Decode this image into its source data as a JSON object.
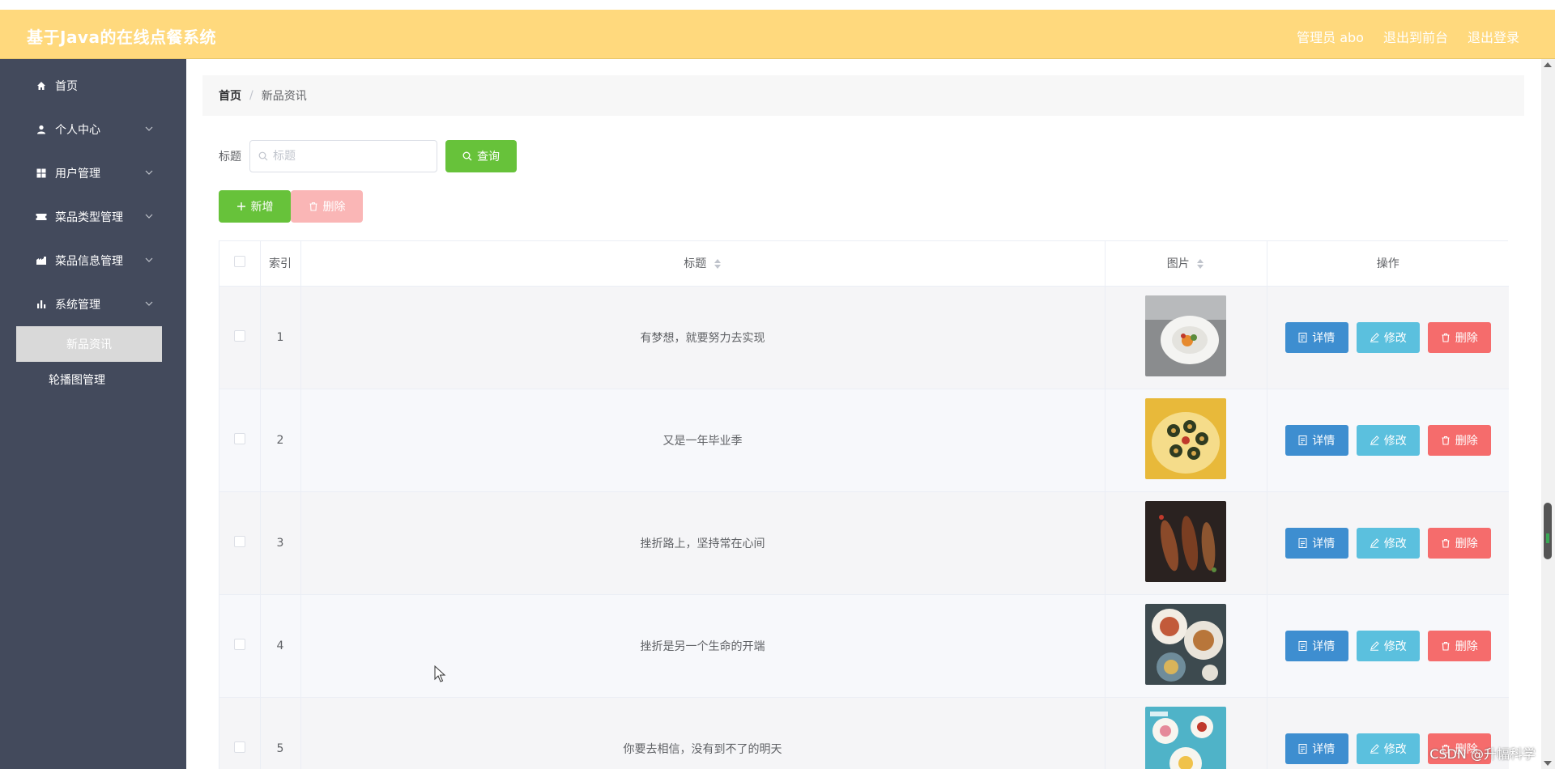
{
  "app": {
    "title": "基于Java的在线点餐系统",
    "header_links": [
      "管理员 abo",
      "退出到前台",
      "退出登录"
    ]
  },
  "sidebar": {
    "items": [
      {
        "label": "首页",
        "icon": "home-icon",
        "has_children": false
      },
      {
        "label": "个人中心",
        "icon": "user-icon",
        "has_children": true
      },
      {
        "label": "用户管理",
        "icon": "grid-icon",
        "has_children": true
      },
      {
        "label": "菜品类型管理",
        "icon": "ticket-icon",
        "has_children": true
      },
      {
        "label": "菜品信息管理",
        "icon": "shop-icon",
        "has_children": true
      },
      {
        "label": "系统管理",
        "icon": "bar-chart-icon",
        "has_children": true
      }
    ],
    "sub_items": [
      {
        "label": "新品资讯",
        "active": true
      },
      {
        "label": "轮播图管理",
        "active": false
      }
    ]
  },
  "breadcrumb": {
    "home": "首页",
    "separator": "/",
    "current": "新品资讯"
  },
  "search": {
    "label": "标题",
    "placeholder": "标题",
    "button": "查询"
  },
  "actions": {
    "add": "新增",
    "delete": "删除"
  },
  "table": {
    "columns": [
      "索引",
      "标题",
      "图片",
      "操作"
    ],
    "rows": [
      {
        "index": "1",
        "title": "有梦想，就要努力去实现",
        "image": "plated-dish-photo"
      },
      {
        "index": "2",
        "title": "又是一年毕业季",
        "image": "sushi-platter-photo"
      },
      {
        "index": "3",
        "title": "挫折路上，坚持常在心间",
        "image": "grilled-fish-photo"
      },
      {
        "index": "4",
        "title": "挫折是另一个生命的开端",
        "image": "table-dishes-photo"
      },
      {
        "index": "5",
        "title": "你要去相信，没有到不了的明天",
        "image": "dessert-table-photo"
      }
    ],
    "row_buttons": {
      "detail": "详情",
      "edit": "修改",
      "delete": "删除"
    }
  },
  "watermark": "CSDN @升幅科学",
  "colors": {
    "header_bg": "#ffd97d",
    "sidebar_bg": "#434a5c",
    "primary_green": "#67c23a",
    "detail_blue": "#3e8ed0",
    "edit_cyan": "#5bc0de",
    "danger_red": "#f56c6c"
  }
}
